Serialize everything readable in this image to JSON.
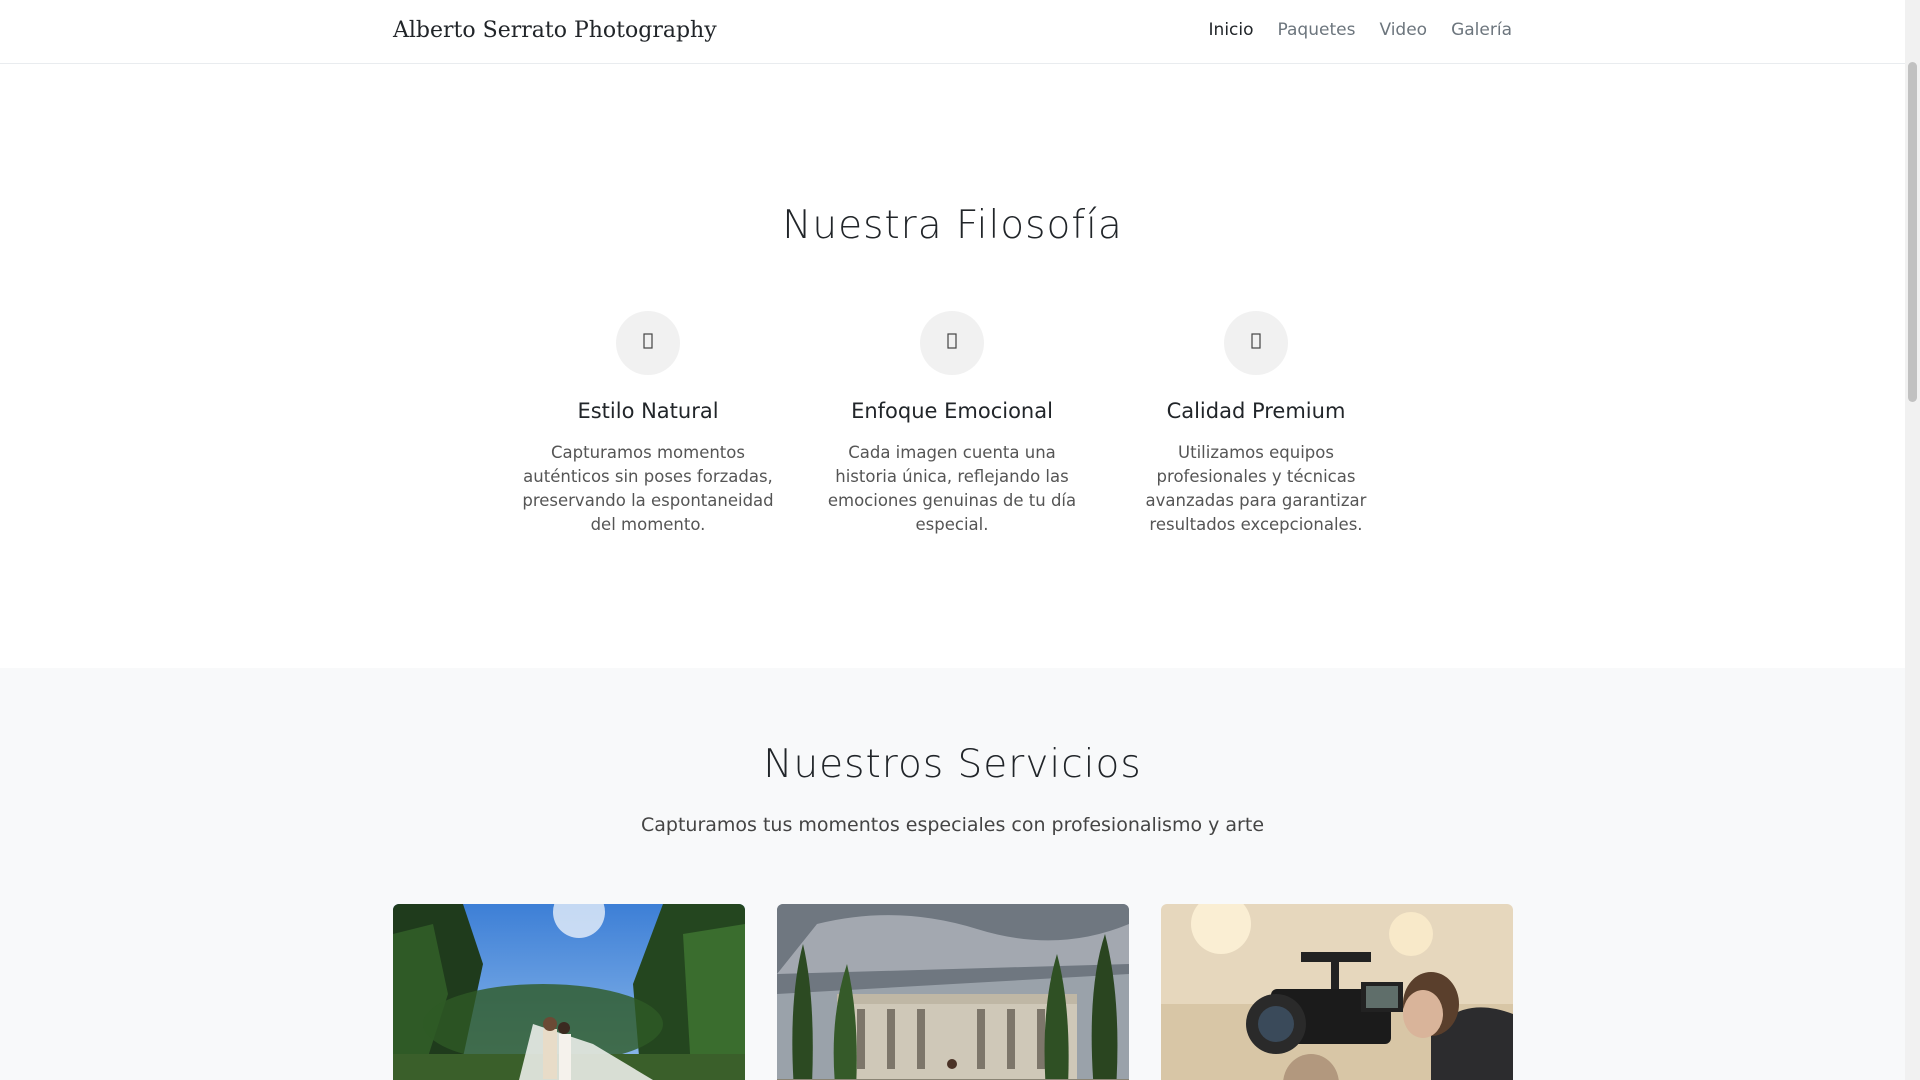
{
  "navbar": {
    "brand": "Alberto Serrato Photography",
    "links": [
      "Inicio",
      "Paquetes",
      "Video",
      "Galería"
    ],
    "active": "Inicio"
  },
  "philosophy": {
    "title": "Nuestra Filosofía",
    "features": [
      {
        "icon": "leaf-icon",
        "title": "Estilo Natural",
        "text": "Capturamos momentos auténticos sin poses forzadas, preservando la espontaneidad del momento."
      },
      {
        "icon": "heart-icon",
        "title": "Enfoque Emocional",
        "text": "Cada imagen cuenta una historia única, reflejando las emociones genuinas de tu día especial."
      },
      {
        "icon": "camera-icon",
        "title": "Calidad Premium",
        "text": "Utilizamos equipos profesionales y técnicas avanzadas para garantizar resultados excepcionales."
      }
    ]
  },
  "services": {
    "title": "Nuestros Servicios",
    "subtitle": "Capturamos tus momentos especiales con profesionalismo y arte",
    "cards": [
      {
        "image": "wedding-couple-forest-photo"
      },
      {
        "image": "quinceanera-garden-mansion-photo"
      },
      {
        "image": "videographer-camera-photo"
      }
    ]
  },
  "colors": {
    "accent": "#212529",
    "muted": "#6c757d",
    "section_bg": "#f8f9fa"
  }
}
